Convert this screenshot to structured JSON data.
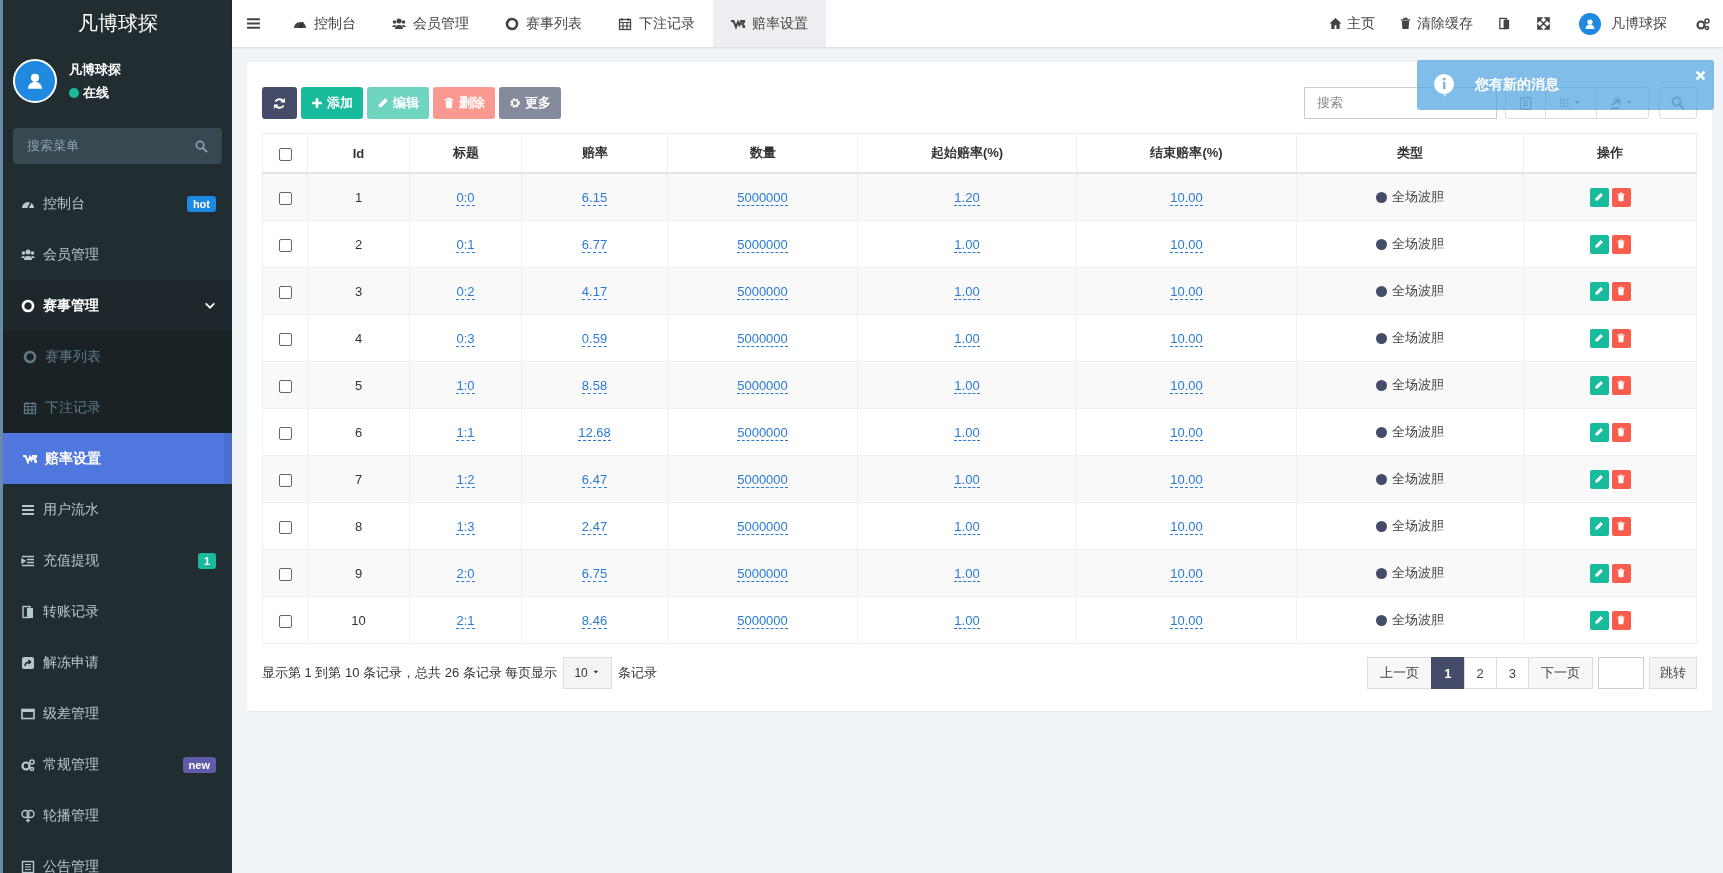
{
  "brand": "凡博球探",
  "user": {
    "name": "凡博球探",
    "status": "在线",
    "online": true
  },
  "sidebar": {
    "search_placeholder": "搜索菜单",
    "items": [
      {
        "label": "控制台",
        "selected": false,
        "badge": {
          "text": "hot",
          "color": "#1e88e5"
        }
      },
      {
        "label": "会员管理",
        "selected": false
      },
      {
        "label": "赛事管理",
        "selected": false,
        "expanded": true,
        "children": [
          {
            "label": "赛事列表",
            "selected": false
          },
          {
            "label": "下注记录",
            "selected": false
          },
          {
            "label": "赔率设置",
            "selected": true
          }
        ]
      },
      {
        "label": "用户流水",
        "selected": false
      },
      {
        "label": "充值提现",
        "selected": false,
        "badge": {
          "text": "1",
          "color": "#18bc9c"
        }
      },
      {
        "label": "转账记录",
        "selected": false
      },
      {
        "label": "解冻申请",
        "selected": false
      },
      {
        "label": "级差管理",
        "selected": false
      },
      {
        "label": "常规管理",
        "selected": false,
        "badge": {
          "text": "new",
          "color": "#605ca8"
        }
      },
      {
        "label": "轮播管理",
        "selected": false
      },
      {
        "label": "公告管理",
        "selected": false
      }
    ]
  },
  "topbar": {
    "tabs": [
      {
        "label": "控制台",
        "selected": false
      },
      {
        "label": "会员管理",
        "selected": false
      },
      {
        "label": "赛事列表",
        "selected": false
      },
      {
        "label": "下注记录",
        "selected": false
      },
      {
        "label": "赔率设置",
        "selected": true
      }
    ],
    "links": [
      "主页",
      "清除缓存"
    ],
    "user_name": "凡博球探"
  },
  "toast": {
    "text": "您有新的消息"
  },
  "toolbar": {
    "buttons": [
      {
        "label": "添加",
        "kind": "add",
        "disabled": false
      },
      {
        "label": "编辑",
        "kind": "edit",
        "disabled": true
      },
      {
        "label": "删除",
        "kind": "delete",
        "disabled": true
      },
      {
        "label": "更多",
        "kind": "more",
        "disabled": false
      }
    ],
    "search_placeholder": "搜索"
  },
  "table": {
    "select_all_checked": false,
    "columns": [
      "Id",
      "标题",
      "赔率",
      "数量",
      "起始赔率(%)",
      "结束赔率(%)",
      "类型",
      "操作"
    ],
    "rows": [
      {
        "checked": false,
        "id": "1",
        "title": "0:0",
        "odds": "6.15",
        "amount": "5000000",
        "start": "1.20",
        "end": "10.00",
        "type": "全场波胆"
      },
      {
        "checked": false,
        "id": "2",
        "title": "0:1",
        "odds": "6.77",
        "amount": "5000000",
        "start": "1.00",
        "end": "10.00",
        "type": "全场波胆"
      },
      {
        "checked": false,
        "id": "3",
        "title": "0:2",
        "odds": "4.17",
        "amount": "5000000",
        "start": "1.00",
        "end": "10.00",
        "type": "全场波胆"
      },
      {
        "checked": false,
        "id": "4",
        "title": "0:3",
        "odds": "0.59",
        "amount": "5000000",
        "start": "1.00",
        "end": "10.00",
        "type": "全场波胆"
      },
      {
        "checked": false,
        "id": "5",
        "title": "1:0",
        "odds": "8.58",
        "amount": "5000000",
        "start": "1.00",
        "end": "10.00",
        "type": "全场波胆"
      },
      {
        "checked": false,
        "id": "6",
        "title": "1:1",
        "odds": "12.68",
        "amount": "5000000",
        "start": "1.00",
        "end": "10.00",
        "type": "全场波胆"
      },
      {
        "checked": false,
        "id": "7",
        "title": "1:2",
        "odds": "6.47",
        "amount": "5000000",
        "start": "1.00",
        "end": "10.00",
        "type": "全场波胆"
      },
      {
        "checked": false,
        "id": "8",
        "title": "1:3",
        "odds": "2.47",
        "amount": "5000000",
        "start": "1.00",
        "end": "10.00",
        "type": "全场波胆"
      },
      {
        "checked": false,
        "id": "9",
        "title": "2:0",
        "odds": "6.75",
        "amount": "5000000",
        "start": "1.00",
        "end": "10.00",
        "type": "全场波胆"
      },
      {
        "checked": false,
        "id": "10",
        "title": "2:1",
        "odds": "8.46",
        "amount": "5000000",
        "start": "1.00",
        "end": "10.00",
        "type": "全场波胆"
      }
    ]
  },
  "pagination": {
    "summary": "显示第 1 到第 10 条记录，总共 26 条记录 每页显示",
    "page_size": "10",
    "suffix": "条记录",
    "prev": "上一页",
    "pages": [
      {
        "label": "1",
        "selected": true
      },
      {
        "label": "2",
        "selected": false
      },
      {
        "label": "3",
        "selected": false
      }
    ],
    "next": "下一页",
    "jump": "跳转"
  }
}
